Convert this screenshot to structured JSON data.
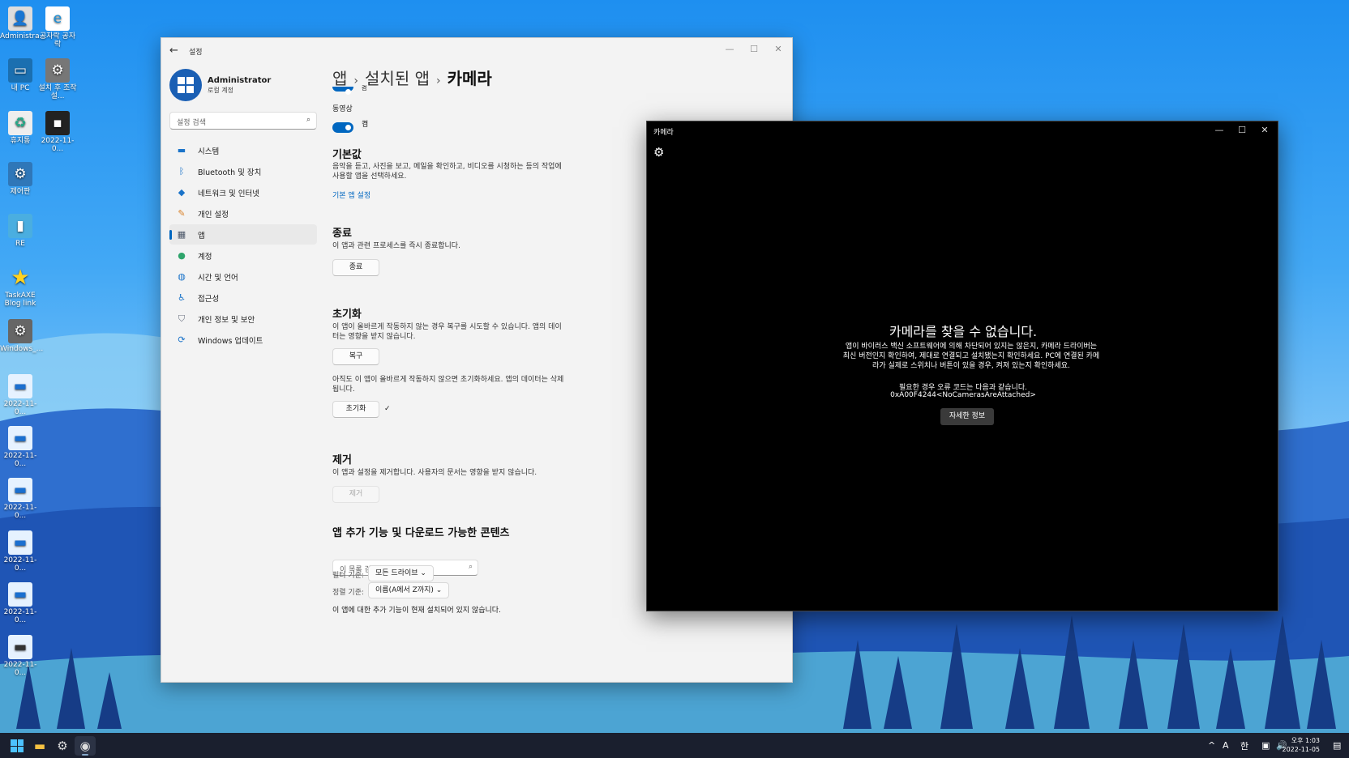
{
  "desktop": {
    "icons": [
      {
        "label": "Administra...",
        "icon": "user-folder-icon"
      },
      {
        "label": "공자락 공자락",
        "icon": "internet-explorer-icon"
      },
      {
        "label": "내 PC",
        "icon": "monitor-icon"
      },
      {
        "label": "설치 후 조작설...",
        "icon": "settings-gear-icon"
      },
      {
        "label": "휴지통",
        "icon": "recycle-bin-icon"
      },
      {
        "label": "2022-11-0...",
        "icon": "screenshot-file-icon"
      },
      {
        "label": "제어판",
        "icon": "control-panel-icon"
      },
      {
        "label": "RE",
        "icon": "book-icon"
      },
      {
        "label": "TaskAXE Blog link",
        "icon": "star-icon"
      },
      {
        "label": "Windows_...",
        "icon": "settings-gear-icon"
      },
      {
        "label": "2022-11-0...",
        "icon": "image-file-icon"
      },
      {
        "label": "2022-11-0...",
        "icon": "image-file-icon"
      },
      {
        "label": "2022-11-0...",
        "icon": "image-file-icon"
      },
      {
        "label": "2022-11-0...",
        "icon": "image-file-icon"
      },
      {
        "label": "2022-11-0...",
        "icon": "image-file-icon"
      },
      {
        "label": "2022-11-0...",
        "icon": "image-file-icon"
      }
    ]
  },
  "settings": {
    "app_title": "설정",
    "user": {
      "name": "Administrator",
      "type": "로컬 계정"
    },
    "search_placeholder": "설정 검색",
    "nav": [
      {
        "label": "시스템",
        "icon": "monitor-icon",
        "color": "#1a73c9"
      },
      {
        "label": "Bluetooth 및 장치",
        "icon": "bluetooth-icon",
        "color": "#1a73c9"
      },
      {
        "label": "네트워크 및 인터넷",
        "icon": "wifi-icon",
        "color": "#1a73c9"
      },
      {
        "label": "개인 설정",
        "icon": "brush-icon",
        "color": "#d9822b"
      },
      {
        "label": "앱",
        "icon": "apps-icon",
        "color": "#4a5568",
        "active": true
      },
      {
        "label": "계정",
        "icon": "person-icon",
        "color": "#2ea46b"
      },
      {
        "label": "시간 및 언어",
        "icon": "globe-clock-icon",
        "color": "#1a73c9"
      },
      {
        "label": "접근성",
        "icon": "accessibility-icon",
        "color": "#1a73c9"
      },
      {
        "label": "개인 정보 및 보안",
        "icon": "shield-icon",
        "color": "#6b7280"
      },
      {
        "label": "Windows 업데이트",
        "icon": "update-icon",
        "color": "#1a73c9"
      }
    ],
    "breadcrumb": [
      "앱",
      "설치된 앱",
      "카메라"
    ],
    "partial_toggle_label": "켬",
    "video": {
      "label": "동영상",
      "state": "켬"
    },
    "defaults": {
      "title": "기본값",
      "desc": "음악을 듣고, 사진을 보고, 메일을 확인하고, 비디오를 시청하는 등의 작업에 사용할 앱을 선택하세요.",
      "link": "기본 앱 설정"
    },
    "terminate": {
      "title": "종료",
      "desc": "이 앱과 관련 프로세스를 즉시 종료합니다.",
      "button": "종료"
    },
    "reset": {
      "title": "초기화",
      "desc": "이 앱이 올바르게 작동하지 않는 경우 복구를 시도할 수 있습니다. 앱의 데이터는 영향을 받지 않습니다.",
      "repair_button": "복구",
      "desc2": "아직도 이 앱이 올바르게 작동하지 않으면 초기화하세요. 앱의 데이터는 삭제됩니다.",
      "reset_button": "초기화",
      "check": "✓"
    },
    "uninstall": {
      "title": "제거",
      "desc": "이 앱과 설정을 제거합니다. 사용자의 문서는 영향을 받지 않습니다.",
      "button": "제거"
    },
    "addons": {
      "title": "앱 추가 기능 및 다운로드 가능한 콘텐츠",
      "search_placeholder": "이 목록 검색",
      "filter_label": "필터 기준:",
      "filter_value": "모든 드라이브",
      "sort_label": "정렬 기준:",
      "sort_value": "이름(A에서 Z까지)",
      "empty": "이 앱에 대한 추가 기능이 현재 설치되어 있지 않습니다."
    }
  },
  "camera": {
    "title": "카메라",
    "error_title": "카메라를 찾을 수 없습니다.",
    "error_body": "앱이 바이러스 백신 소프트웨어에 의해 차단되어 있지는 않은지, 카메라 드라이버는 최신 버전인지 확인하여, 제대로 연결되고 설치됐는지 확인하세요. PC에 연결된 카메라가 실제로 스위치나 버튼이 있을 경우, 켜져 있는지 확인하세요.",
    "error_code_label": "필요한 경우 오류 코드는 다음과 같습니다.",
    "error_code": "0xA00F4244<NoCamerasAreAttached>",
    "more_button": "자세한 정보"
  },
  "taskbar": {
    "apps": [
      "start-icon",
      "file-explorer-icon",
      "settings-icon",
      "camera-icon"
    ],
    "tray": {
      "chevron": "^",
      "ime_mode": "A",
      "ime_lang": "한"
    },
    "time": "오후 1:03",
    "date": "2022-11-05"
  }
}
